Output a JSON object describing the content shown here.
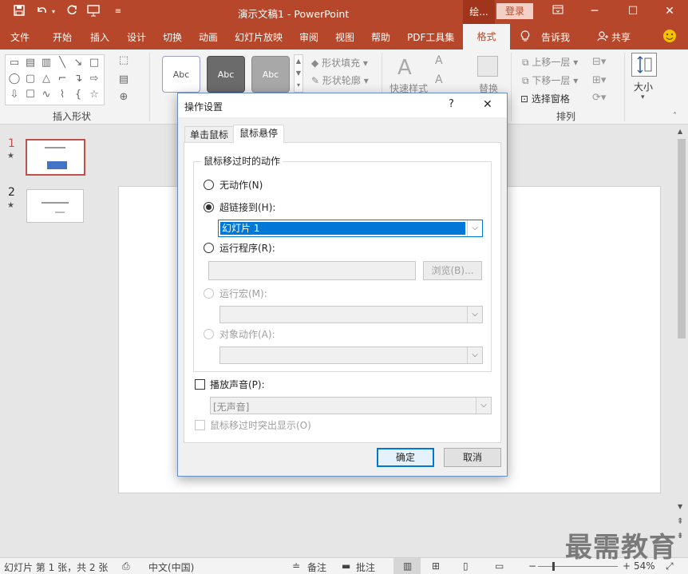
{
  "titlebar": {
    "doc_title": "演示文稿1  -  PowerPoint",
    "drawing_tools_tab": "绘...",
    "login_label": "登录",
    "quick_access_icons": [
      "save-icon",
      "undo-icon",
      "redo-icon",
      "start-from-beginning-icon",
      "customize-icon"
    ],
    "window_icons": [
      "ribbon-display-options-icon",
      "minimize-icon",
      "maximize-icon",
      "close-icon"
    ]
  },
  "menu": {
    "items": [
      "文件",
      "开始",
      "插入",
      "设计",
      "切换",
      "动画",
      "幻灯片放映",
      "审阅",
      "视图",
      "帮助",
      "PDF工具集",
      "格式"
    ],
    "tell_me": "告诉我",
    "share": "共享",
    "active_tab": "格式"
  },
  "ribbon": {
    "insert_shapes_label": "插入形状",
    "style_preview_text": "Abc",
    "shape_fill": "形状填充",
    "shape_outline": "形状轮廓",
    "quick_styles": "快速样式",
    "replace": "替换",
    "bring_forward": "上移一层",
    "send_backward": "下移一层",
    "selection_pane": "选择窗格",
    "arrange_label": "排列",
    "size_label": "大小"
  },
  "slides": [
    {
      "number": "1",
      "selected": true
    },
    {
      "number": "2",
      "selected": false
    }
  ],
  "dialog": {
    "title": "操作设置",
    "help": "?",
    "close": "✕",
    "tabs": [
      "单击鼠标",
      "鼠标悬停"
    ],
    "active_tab": "鼠标悬停",
    "group_caption": "鼠标移过时的动作",
    "options": {
      "none": "无动作(N)",
      "hyperlink": "超链接到(H):",
      "run_program": "运行程序(R):",
      "run_macro": "运行宏(M):",
      "object_action": "对象动作(A):"
    },
    "selected_option": "hyperlink",
    "hyperlink_value": "幻灯片 1",
    "program_value": "",
    "browse_button": "浏览(B)...",
    "play_sound_label": "播放声音(P):",
    "sound_value": "[无声音]",
    "highlight_label": "鼠标移过时突出显示(O)",
    "ok": "确定",
    "cancel": "取消"
  },
  "status": {
    "slide_info": "幻灯片 第 1 张，共 2 张",
    "language": "中文(中国)",
    "notes": "备注",
    "comments": "批注",
    "zoom": "54%"
  },
  "watermark": "最需教育",
  "colors": {
    "brand": "#b7472a",
    "highlight": "#0078d7",
    "selected_thumb_border": "#c0504d"
  }
}
